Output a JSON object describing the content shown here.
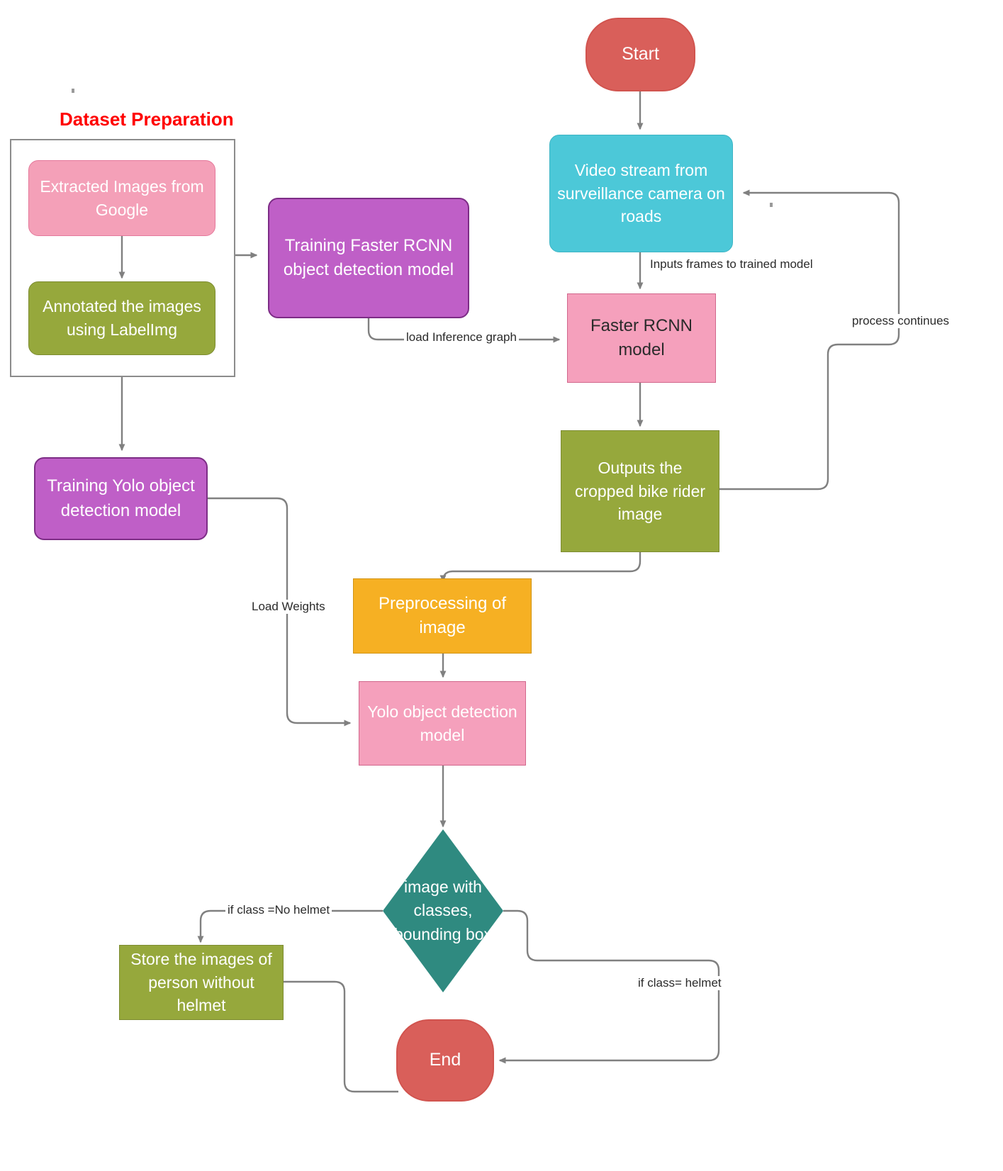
{
  "diagram": {
    "title_group": "Dataset Preparation",
    "nodes": {
      "start": "Start",
      "video_stream": "Video stream from surveillance camera on roads",
      "faster_rcnn_model": "Faster RCNN model",
      "outputs_cropped": "Outputs the cropped bike rider image",
      "extracted_images": "Extracted Images from Google",
      "annotated_images": "Annotated the images using LabelImg",
      "training_frcnn": "Training Faster RCNN object detection model",
      "training_yolo": "Training  Yolo object detection model",
      "preprocessing": "Preprocessing of image",
      "yolo_model": "Yolo object detection model",
      "decision": "image with classes, bounding box",
      "store_images": "Store the images of person without helmet",
      "end": "End"
    },
    "edge_labels": {
      "inputs_frames": "Inputs frames to trained model",
      "process_continues": "process continues",
      "load_inference_graph": "load Inference graph",
      "load_weights": "Load Weights",
      "if_no_helmet": "if class =No helmet",
      "if_helmet": "if class= helmet"
    },
    "colors": {
      "terminator": "#d95f5a",
      "pink_soft": "#f4a0b8",
      "pink_plain": "#f5a0bc",
      "olive": "#96a83c",
      "purple": "#bf5fc7",
      "cyan": "#4cc8d8",
      "amber": "#f6b023",
      "teal": "#2f8a80",
      "group_title": "#ff0000",
      "connector": "#808080"
    }
  }
}
